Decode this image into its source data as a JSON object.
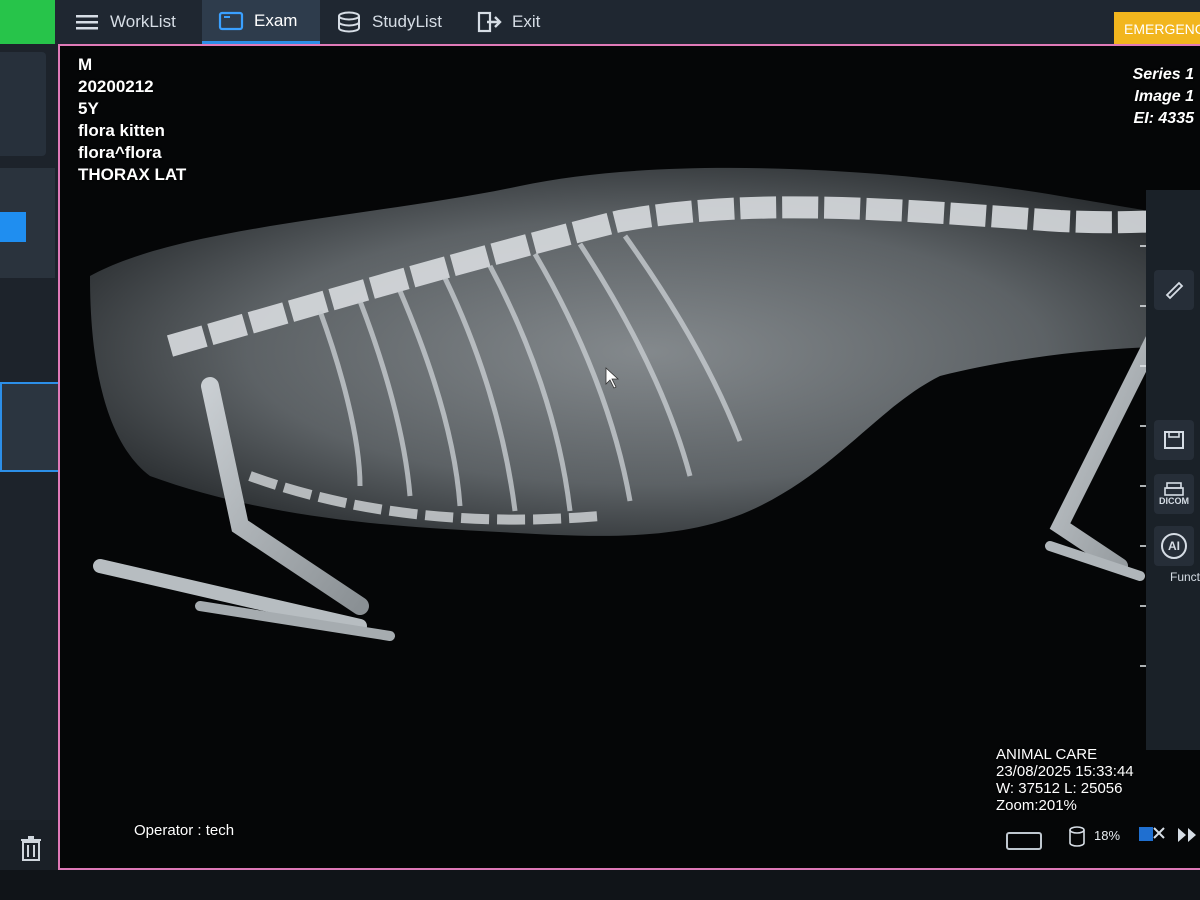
{
  "nav": {
    "tabs": [
      {
        "label": "WorkList",
        "icon": "menu-icon"
      },
      {
        "label": "Exam",
        "icon": "window-icon",
        "active": true
      },
      {
        "label": "StudyList",
        "icon": "database-icon"
      },
      {
        "label": "Exit",
        "icon": "exit-icon"
      }
    ],
    "emergency_label": "EMERGENCY"
  },
  "overlay": {
    "patient": {
      "sex": "M",
      "id": "20200212",
      "age": "5Y",
      "name": "flora kitten",
      "owner": "flora^flora",
      "exam": "THORAX LAT"
    },
    "series": "Series 1",
    "image": "Image 1",
    "ei": "EI: 4335",
    "institution": "ANIMAL CARE",
    "datetime": "23/08/2025 15:33:44",
    "window_level": "W: 37512 L: 25056",
    "zoom": "Zoom:201%",
    "operator": "Operator : tech"
  },
  "right_tools": {
    "functions_label": "Funct",
    "dicom_label": "DICOM",
    "ai_label": "AI"
  },
  "status": {
    "disk_usage": "18%"
  },
  "colors": {
    "accent": "#2c8fe8",
    "emergency": "#f2b61e",
    "viewer_border": "#e07ab8",
    "status_green": "#27c44a"
  }
}
